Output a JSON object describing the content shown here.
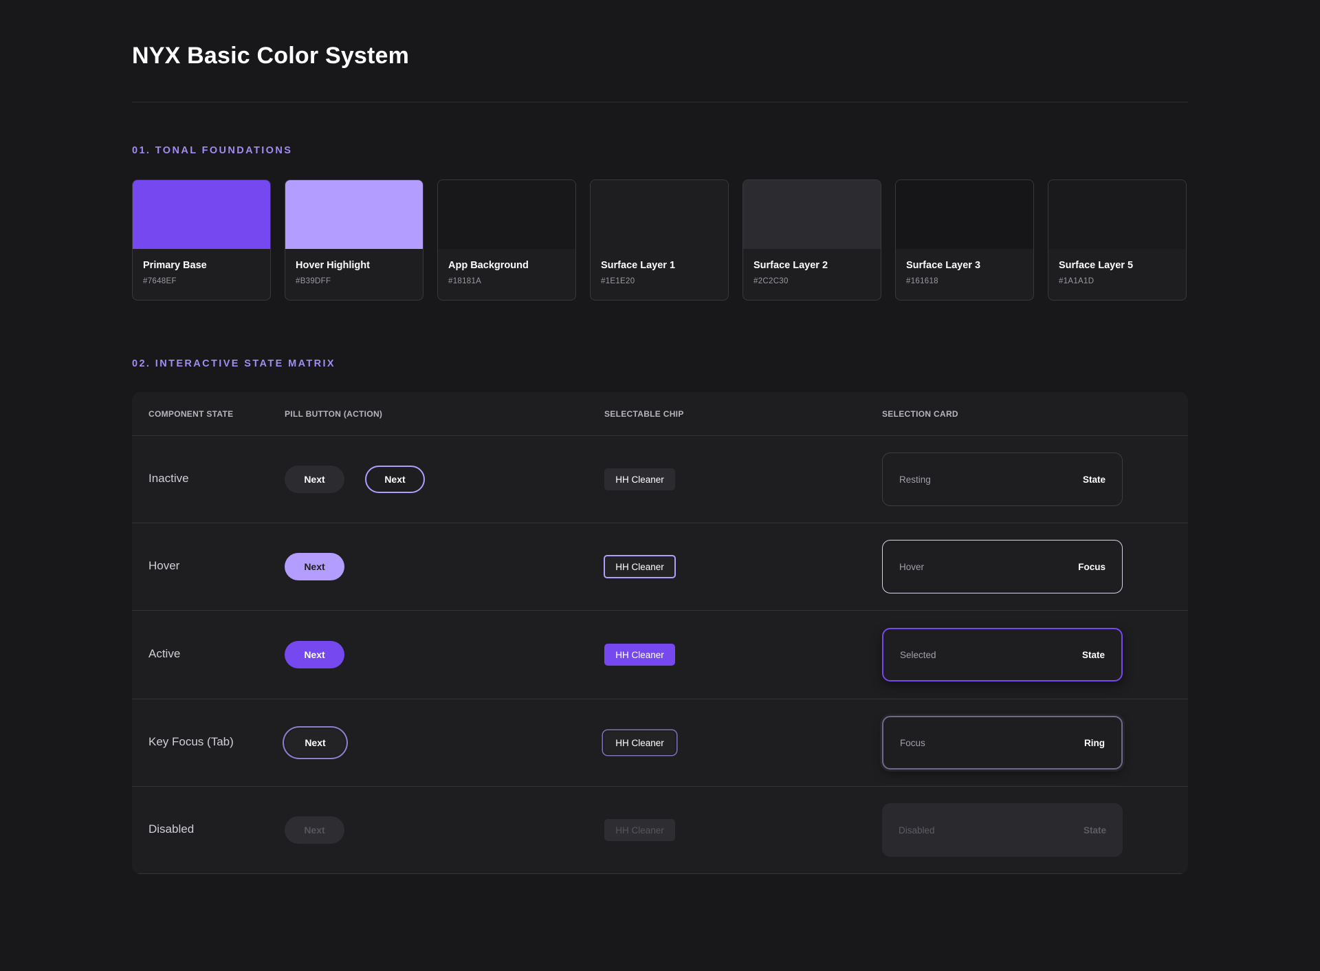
{
  "page_title": "NYX Basic Color System",
  "sections": {
    "tonal": {
      "heading": "01. TONAL FOUNDATIONS"
    },
    "matrix": {
      "heading": "02. INTERACTIVE STATE MATRIX"
    }
  },
  "swatches": [
    {
      "name": "Primary Base",
      "hex": "#7648EF",
      "color": "#7648EF"
    },
    {
      "name": "Hover Highlight",
      "hex": "#B39DFF",
      "color": "#B39DFF"
    },
    {
      "name": "App Background",
      "hex": "#18181A",
      "color": "#18181A"
    },
    {
      "name": "Surface Layer 1",
      "hex": "#1E1E20",
      "color": "#1E1E20"
    },
    {
      "name": "Surface Layer 2",
      "hex": "#2C2C30",
      "color": "#2C2C30"
    },
    {
      "name": "Surface Layer 3",
      "hex": "#161618",
      "color": "#161618"
    },
    {
      "name": "Surface Layer 5",
      "hex": "#1A1A1D",
      "color": "#1A1A1D"
    }
  ],
  "matrix": {
    "headers": {
      "state": "COMPONENT STATE",
      "pill": "PILL BUTTON (ACTION)",
      "chip": "SELECTABLE CHIP",
      "card": "SELECTION CARD"
    },
    "rows": [
      {
        "label": "Inactive",
        "pill": "Next",
        "pill_outline": "Next",
        "chip": "HH Cleaner",
        "card_left": "Resting",
        "card_right": "State"
      },
      {
        "label": "Hover",
        "pill": "Next",
        "chip": "HH Cleaner",
        "card_left": "Hover",
        "card_right": "Focus"
      },
      {
        "label": "Active",
        "pill": "Next",
        "chip": "HH Cleaner",
        "card_left": "Selected",
        "card_right": "State"
      },
      {
        "label": "Key Focus (Tab)",
        "pill": "Next",
        "chip": "HH Cleaner",
        "card_left": "Focus",
        "card_right": "Ring"
      },
      {
        "label": "Disabled",
        "pill": "Next",
        "chip": "HH Cleaner",
        "card_left": "Disabled",
        "card_right": "State"
      }
    ]
  }
}
